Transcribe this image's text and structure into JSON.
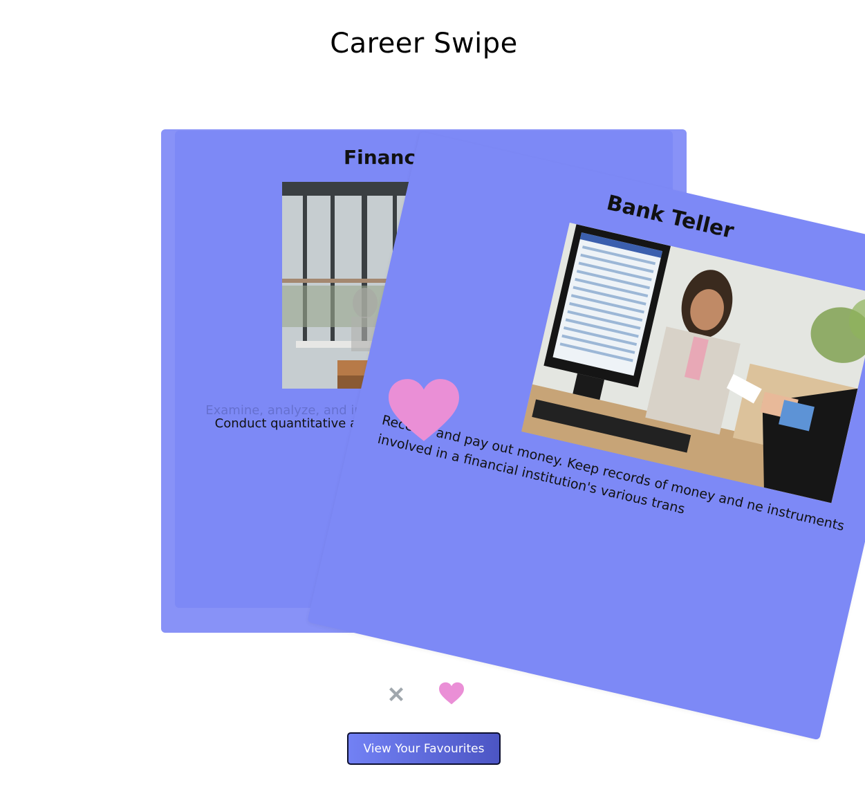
{
  "page": {
    "title": "Career Swipe"
  },
  "cards": {
    "back": {
      "title": "Financial Anal",
      "ghost_description": "Examine, analyze, and interpret ... statistical data ... of ... valuation ...",
      "description": "Conduct quantitative analyses of programs or financial data of pub valuation o",
      "image_icon": "office-laptop-photo"
    },
    "front": {
      "title": "Bank Teller",
      "description": "Receive and pay out money. Keep records of money and ne instruments involved in a financial institution's various trans",
      "image_icon": "bank-teller-photo"
    }
  },
  "overlay": {
    "like_icon": "heart-icon"
  },
  "actions": {
    "dislike_icon": "close-icon",
    "like_icon": "heart-icon",
    "favourites_label": "View Your Favourites"
  },
  "colors": {
    "card": "#7d89f6",
    "card_back": "#8892f7",
    "heart": "#ea8fd6",
    "x": "#a0a7ad",
    "button_start": "#7281f4",
    "button_end": "#4c55c4"
  }
}
